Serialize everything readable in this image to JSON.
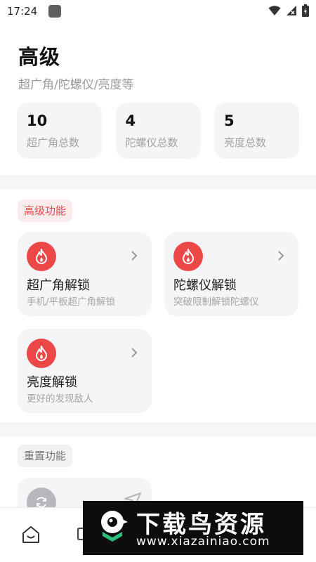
{
  "status_bar": {
    "time": "17:24"
  },
  "header": {
    "title": "高级",
    "subtitle": "超广角/陀螺仪/亮度等"
  },
  "stats": [
    {
      "value": "10",
      "label": "超广角总数"
    },
    {
      "value": "4",
      "label": "陀螺仪总数"
    },
    {
      "value": "5",
      "label": "亮度总数"
    }
  ],
  "advanced_section": {
    "tag": "高级功能",
    "features": [
      {
        "title": "超广角解锁",
        "desc": "手机/平板超广角解锁"
      },
      {
        "title": "陀螺仪解锁",
        "desc": "突破限制解锁陀螺仪"
      },
      {
        "title": "亮度解锁",
        "desc": "更好的发现敌人"
      }
    ]
  },
  "reset_section": {
    "tag": "重置功能"
  },
  "watermark": {
    "title": "下载鸟资源",
    "url": "www.xiazainiao.com"
  },
  "colors": {
    "accent": "#ec4848",
    "card_bg": "#f5f5f7",
    "muted_text": "#a6a6a6"
  }
}
